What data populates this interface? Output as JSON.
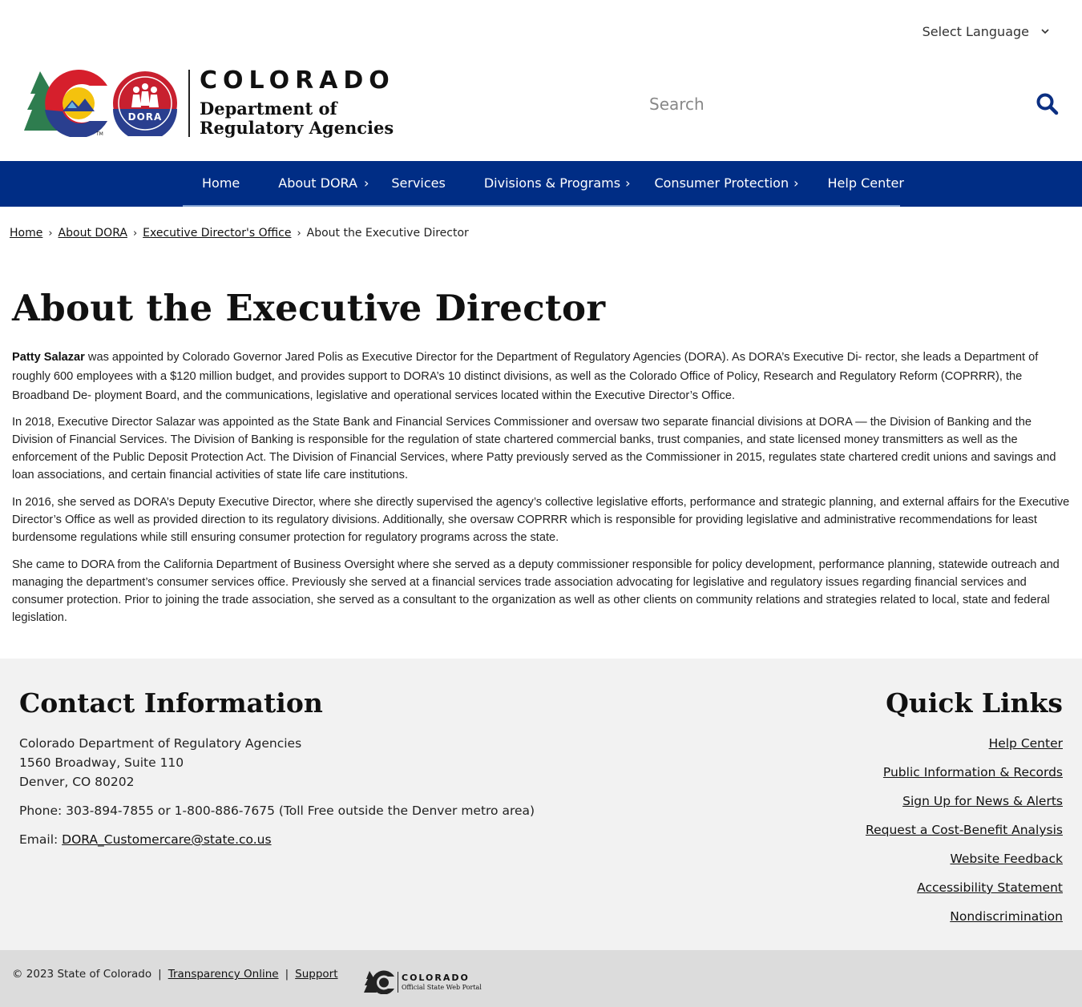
{
  "header": {
    "language_label": "Select Language",
    "logo": {
      "wordmark": "COLORADO",
      "dept_line1": "Department of",
      "dept_line2": "Regulatory Agencies",
      "badge_text": "DORA"
    },
    "search_placeholder": "Search"
  },
  "nav": {
    "items": [
      {
        "label": "Home",
        "has_submenu": false
      },
      {
        "label": "About DORA",
        "has_submenu": true
      },
      {
        "label": "Services",
        "has_submenu": false
      },
      {
        "label": "Divisions & Programs",
        "has_submenu": true
      },
      {
        "label": "Consumer Protection",
        "has_submenu": true
      },
      {
        "label": "Help Center",
        "has_submenu": false
      }
    ],
    "chevron": "›"
  },
  "breadcrumb": {
    "items": [
      "Home",
      "About DORA",
      "Executive Director's Office"
    ],
    "current": "About the Executive Director",
    "separator": "›"
  },
  "main": {
    "title": "About the Executive Director",
    "p1_name": "Patty Salazar",
    "p1_rest": " was appointed by Colorado Governor Jared Polis as Executive Director for the Department of Regulatory Agencies (DORA). As DORA’s Executive Di- rector, she leads a Department of roughly 600 employees with a $120 million budget, and provides support to DORA’s 10 distinct divisions, as well as the Colorado Office of Policy, Research and Regulatory Reform (COPRRR), the Broadband De- ployment Board, and the communications, legislative and operational services located within the Executive Director’s Office.",
    "p2": "In 2018, Executive Director Salazar was appointed as the State Bank and Financial Services Commissioner and oversaw two separate financial divisions at DORA — the Division of Banking and the Division of Financial Services. The Division of Banking is responsible for the regulation of state chartered commercial banks, trust companies, and state licensed money transmitters as well as the enforcement of the Public Deposit Protection Act. The Division of Financial Services, where Patty previously served as the Commissioner in 2015, regulates state chartered credit unions and savings and loan associations, and certain financial activities of state life care institutions.",
    "p3": "In 2016, she served as DORA’s Deputy Executive Director, where she directly supervised the agency’s collective legislative efforts, performance and strategic planning, and external affairs for the Executive Director’s Office as well as provided direction to its regulatory divisions. Additionally, she oversaw COPRRR which is responsible for providing legislative and administrative recommendations for least burdensome regulations while still ensuring consumer protection for regulatory programs across the state.",
    "p4": "She came to DORA from the California Department of Business Oversight where she served as a deputy commissioner responsible for policy development, performance planning, statewide outreach and managing the department’s consumer services office. Previously she served at a financial services trade association advocating for legislative and regulatory issues regarding financial services and consumer protection. Prior to joining the trade association, she served as a consultant to the organization as well as other clients on community relations and strategies related to local, state and federal legislation."
  },
  "footer": {
    "contact": {
      "title": "Contact Information",
      "org": "Colorado Department of Regulatory Agencies",
      "address1": "1560 Broadway, Suite 110",
      "address2": "Denver, CO 80202",
      "phone": "Phone: 303-894-7855 or 1-800-886-7675 (Toll Free outside the Denver metro area)",
      "email_label": "Email: ",
      "email": "DORA_Customercare@state.co.us"
    },
    "quick_links": {
      "title": "Quick Links",
      "links": [
        "Help Center",
        "Public Information & Records",
        "Sign Up for News & Alerts",
        "Request a Cost-Benefit Analysis",
        "Website Feedback",
        "Accessibility Statement",
        "Nondiscrimination"
      ]
    },
    "bottom": {
      "copyright": "© 2023 State of Colorado",
      "pipe": "|",
      "transparency": "Transparency Online",
      "support": "Support",
      "portal_wordmark": "COLORADO",
      "portal_sub": "Official State Web Portal"
    }
  },
  "colors": {
    "nav_bg": "#002d85",
    "search_icon": "#0b2f82",
    "footer_bg": "#f2f2f2",
    "footer_bottom_bg": "#dcdcdc"
  }
}
